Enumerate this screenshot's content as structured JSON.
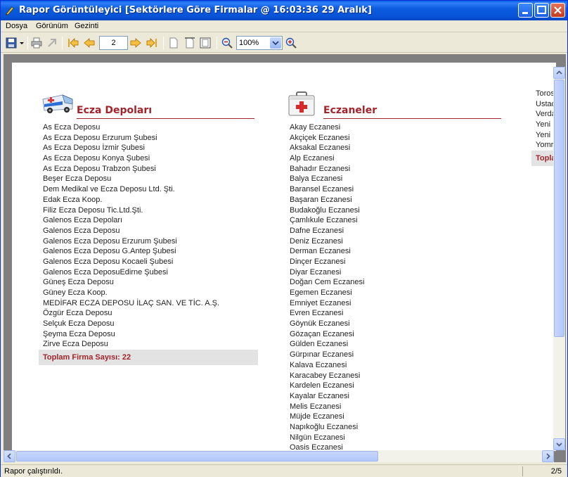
{
  "window": {
    "title": "Rapor Görüntüleyici [Sektörlere Göre Firmalar @ 16:03:36 29 Aralık]"
  },
  "menu": [
    "Dosya",
    "Görünüm",
    "Gezinti"
  ],
  "toolbar": {
    "page_number": "2",
    "zoom": "100%"
  },
  "report": {
    "ecza_depolari": {
      "title": "Ecza Depoları",
      "items": [
        "As Ecza Deposu",
        "As Ecza Deposu  Erzurum Şubesi",
        "As Ecza Deposu İzmir Şubesi",
        "As Ecza Deposu Konya Şubesi",
        "As Ecza Deposu Trabzon Şubesi",
        "Beşer Ecza Deposu",
        "Dem Medikal ve Ecza Deposu Ltd. Şti.",
        "Edak Ecza Koop.",
        "Filiz Ecza Deposu Tic.Ltd.Şti.",
        "Galenos Ecza Depoları",
        "Galenos Ecza Deposu",
        "Galenos Ecza Deposu Erzurum Şubesi",
        "Galenos Ecza Deposu G.Antep Şubesi",
        "Galenos Ecza Deposu Kocaeli Şubesi",
        "Galenos Ecza DeposuEdirne Şubesi",
        "Güneş Ecza Deposu",
        "Güney Ecza Koop.",
        "MEDİFAR ECZA DEPOSU İLAÇ SAN. VE TİC. A.Ş.",
        "Özgür Ecza Deposu",
        "Selçuk Ecza Deposu",
        "Şeyma Ecza Deposu",
        "Zirve Ecza Deposu"
      ],
      "total": "Toplam Firma Sayısı: 22"
    },
    "eczaneler": {
      "title": "Eczaneler",
      "items": [
        "Akay Eczanesi",
        "Akçiçek Eczanesi",
        "Aksakal Eczanesi",
        "Alp Eczanesi",
        "Bahadır Eczanesi",
        "Balya Eczanesi",
        "Baransel Eczanesi",
        "Başaran Eczanesi",
        "Budakoğlu Eczanesi",
        "Çamlıkule Eczanesi",
        "Dafne Eczanesi",
        "Deniz Eczanesi",
        "Derman Eczanesi",
        "Dinçer Eczanesi",
        "Diyar Eczanesi",
        "Doğan Cem Eczanesi",
        "Egemen Eczanesi",
        "Emniyet Eczanesi",
        "Evren Eczanesi",
        "Göynük Eczanesi",
        "Gözaçan Eczanesi",
        "Gülden Eczanesi",
        "Gürpınar Eczanesi",
        "Kalava Eczanesi",
        "Karacabey Eczanesi",
        "Kardelen Eczanesi",
        "Kayalar Eczanesi",
        "Melis Eczanesi",
        "Müjde Eczanesi",
        "Napıkoğlu Eczanesi",
        "Nilgün Eczanesi",
        "Oasis Eczanesi"
      ]
    },
    "third_column": {
      "items": [
        "Toros",
        "Ustad",
        "Verda",
        "Yeni",
        "Yeni",
        "Yomr"
      ],
      "total": "Topla"
    }
  },
  "status": {
    "message": "Rapor çalıştırıldı.",
    "page": "2/5"
  },
  "colors": {
    "accent": "#a1242b",
    "titlebar": "#0853d6",
    "total_bg": "#e3e3e3"
  }
}
